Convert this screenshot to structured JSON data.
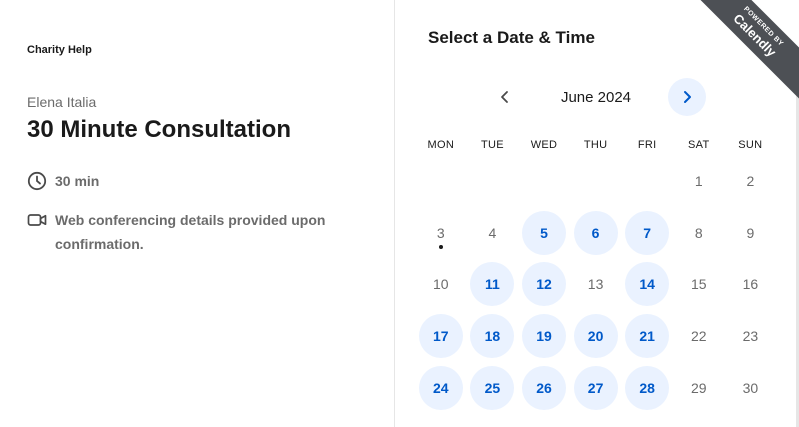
{
  "brand": "Charity Help",
  "host_name": "Elena Italia",
  "event_title": "30 Minute Consultation",
  "duration": "30 min",
  "conferencing": "Web conferencing details provided upon confirmation.",
  "panel_title": "Select a Date & Time",
  "month_label": "June 2024",
  "weekdays": [
    "MON",
    "TUE",
    "WED",
    "THU",
    "FRI",
    "SAT",
    "SUN"
  ],
  "ribbon": {
    "top": "POWERED BY",
    "main": "Calendly"
  },
  "colors": {
    "accent": "#0059c9",
    "available_bg": "#eaf2ff",
    "ribbon_bg": "#4d5055",
    "muted_text": "#6b6b6b"
  },
  "icons": {
    "duration": "clock-icon",
    "conferencing": "video-camera-icon",
    "prev": "chevron-left-icon",
    "next": "chevron-right-icon"
  },
  "calendar": {
    "weeks": [
      [
        {
          "d": null
        },
        {
          "d": null
        },
        {
          "d": null
        },
        {
          "d": null
        },
        {
          "d": null
        },
        {
          "d": "1",
          "available": false
        },
        {
          "d": "2",
          "available": false
        }
      ],
      [
        {
          "d": "3",
          "available": false,
          "today": true
        },
        {
          "d": "4",
          "available": false
        },
        {
          "d": "5",
          "available": true
        },
        {
          "d": "6",
          "available": true
        },
        {
          "d": "7",
          "available": true
        },
        {
          "d": "8",
          "available": false
        },
        {
          "d": "9",
          "available": false
        }
      ],
      [
        {
          "d": "10",
          "available": false
        },
        {
          "d": "11",
          "available": true
        },
        {
          "d": "12",
          "available": true
        },
        {
          "d": "13",
          "available": false
        },
        {
          "d": "14",
          "available": true
        },
        {
          "d": "15",
          "available": false
        },
        {
          "d": "16",
          "available": false
        }
      ],
      [
        {
          "d": "17",
          "available": true
        },
        {
          "d": "18",
          "available": true
        },
        {
          "d": "19",
          "available": true
        },
        {
          "d": "20",
          "available": true
        },
        {
          "d": "21",
          "available": true
        },
        {
          "d": "22",
          "available": false
        },
        {
          "d": "23",
          "available": false
        }
      ],
      [
        {
          "d": "24",
          "available": true
        },
        {
          "d": "25",
          "available": true
        },
        {
          "d": "26",
          "available": true
        },
        {
          "d": "27",
          "available": true
        },
        {
          "d": "28",
          "available": true
        },
        {
          "d": "29",
          "available": false
        },
        {
          "d": "30",
          "available": false
        }
      ]
    ]
  }
}
